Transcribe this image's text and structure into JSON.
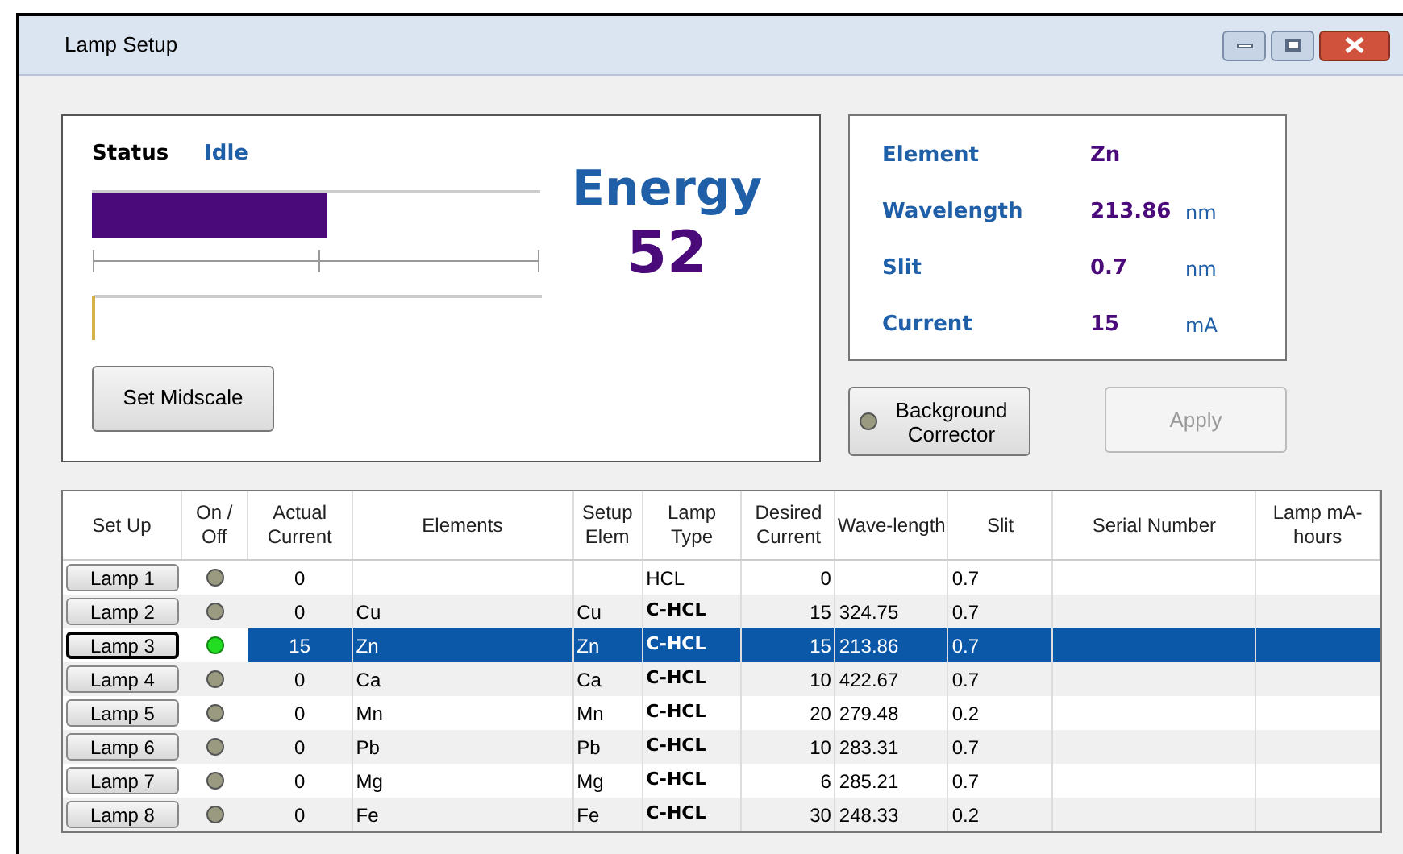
{
  "window": {
    "title": "Lamp Setup"
  },
  "status": {
    "label": "Status",
    "value": "Idle"
  },
  "energy": {
    "label": "Energy",
    "value": "52",
    "level": 0.525
  },
  "set_midscale_button": "Set Midscale",
  "info": [
    {
      "label": "Element",
      "value": "Zn"
    },
    {
      "label": "Wavelength",
      "value": "213.86",
      "unit": "nm"
    },
    {
      "label": "Slit",
      "value": "0.7",
      "unit": "nm"
    },
    {
      "label": "Current",
      "value": "15",
      "unit": "mA"
    }
  ],
  "background_corrector": {
    "label": "Background Corrector",
    "on": false
  },
  "apply_button": {
    "label": "Apply",
    "disabled": true
  },
  "table": {
    "columns": [
      "Set Up",
      "On / Off",
      "Actual Current",
      "Elements",
      "Setup Elem",
      "Lamp Type",
      "Desired Current",
      "Wave-length",
      "Slit",
      "Serial Number",
      "Lamp mA-hours"
    ],
    "rows": [
      {
        "lamp": "Lamp 1",
        "on": false,
        "selected": false,
        "focused": false,
        "actual": "0",
        "element": "",
        "setup_elem": "",
        "lamp_type": "HCL",
        "lamp_type_bold": false,
        "desired": "0",
        "wavelength": "",
        "slit": "0.7"
      },
      {
        "lamp": "Lamp 2",
        "on": false,
        "selected": false,
        "focused": false,
        "actual": "0",
        "element": "Cu",
        "setup_elem": "Cu",
        "lamp_type": "C-HCL",
        "lamp_type_bold": true,
        "desired": "15",
        "wavelength": "324.75",
        "slit": "0.7"
      },
      {
        "lamp": "Lamp 3",
        "on": true,
        "selected": true,
        "focused": true,
        "actual": "15",
        "element": "Zn",
        "setup_elem": "Zn",
        "lamp_type": "C-HCL",
        "lamp_type_bold": true,
        "desired": "15",
        "wavelength": "213.86",
        "slit": "0.7"
      },
      {
        "lamp": "Lamp 4",
        "on": false,
        "selected": false,
        "focused": false,
        "actual": "0",
        "element": "Ca",
        "setup_elem": "Ca",
        "lamp_type": "C-HCL",
        "lamp_type_bold": true,
        "desired": "10",
        "wavelength": "422.67",
        "slit": "0.7"
      },
      {
        "lamp": "Lamp 5",
        "on": false,
        "selected": false,
        "focused": false,
        "actual": "0",
        "element": "Mn",
        "setup_elem": "Mn",
        "lamp_type": "C-HCL",
        "lamp_type_bold": true,
        "desired": "20",
        "wavelength": "279.48",
        "slit": "0.2"
      },
      {
        "lamp": "Lamp 6",
        "on": false,
        "selected": false,
        "focused": false,
        "actual": "0",
        "element": "Pb",
        "setup_elem": "Pb",
        "lamp_type": "C-HCL",
        "lamp_type_bold": true,
        "desired": "10",
        "wavelength": "283.31",
        "slit": "0.7"
      },
      {
        "lamp": "Lamp 7",
        "on": false,
        "selected": false,
        "focused": false,
        "actual": "0",
        "element": "Mg",
        "setup_elem": "Mg",
        "lamp_type": "C-HCL",
        "lamp_type_bold": true,
        "desired": "6",
        "wavelength": "285.21",
        "slit": "0.7"
      },
      {
        "lamp": "Lamp 8",
        "on": false,
        "selected": false,
        "focused": false,
        "actual": "0",
        "element": "Fe",
        "setup_elem": "Fe",
        "lamp_type": "C-HCL",
        "lamp_type_bold": true,
        "desired": "30",
        "wavelength": "248.33",
        "slit": "0.2"
      }
    ]
  }
}
